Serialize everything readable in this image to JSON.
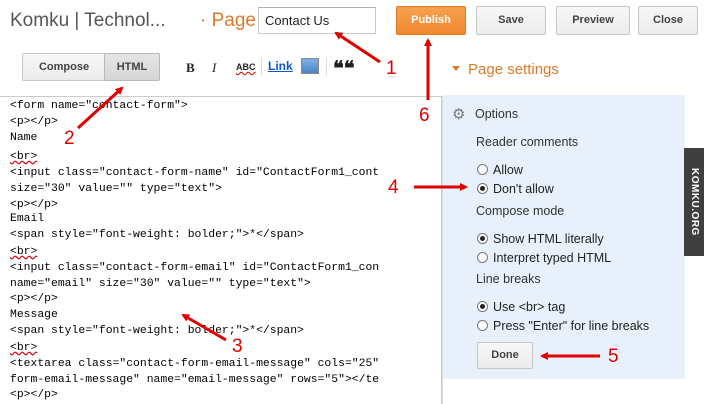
{
  "header": {
    "blog_title": "Komku | Technol...",
    "page_label": "· Page",
    "page_title_value": "Contact Us",
    "publish_label": "Publish",
    "save_label": "Save",
    "preview_label": "Preview",
    "close_label": "Close"
  },
  "editor_modes": {
    "compose_label": "Compose",
    "html_label": "HTML",
    "active": "HTML"
  },
  "toolbar": {
    "bold_label": "B",
    "italic_label": "I",
    "spellcheck_label": "ABC",
    "link_label": "Link",
    "image_icon": "image-icon",
    "quote_label": "❝❝"
  },
  "code_lines": [
    "<form name=\"contact-form\">",
    "<p></p>",
    "Name",
    "<br>",
    "<input class=\"contact-form-name\" id=\"ContactForm1_cont",
    "size=\"30\" value=\"\" type=\"text\">",
    "<p></p>",
    "Email",
    "<span style=\"font-weight: bolder;\">*</span>",
    "<br>",
    "<input class=\"contact-form-email\" id=\"ContactForm1_con",
    "name=\"email\" size=\"30\" value=\"\" type=\"text\">",
    "<p></p>",
    "Message",
    "<span style=\"font-weight: bolder;\">*</span>",
    "<br>",
    "<textarea class=\"contact-form-email-message\" cols=\"25\"",
    "form-email-message\" name=\"email-message\" rows=\"5\"></te",
    "<p></p>"
  ],
  "page_settings": {
    "title": "Page settings",
    "options_title": "Options",
    "reader_comments": {
      "label": "Reader comments",
      "options": [
        "Allow",
        "Don't allow"
      ],
      "selected": "Don't allow"
    },
    "compose_mode": {
      "label": "Compose mode",
      "options": [
        "Show HTML literally",
        "Interpret typed HTML"
      ],
      "selected": "Show HTML literally"
    },
    "line_breaks": {
      "label": "Line breaks",
      "options": [
        "Use <br> tag",
        "Press \"Enter\" for line breaks"
      ],
      "selected": "Use <br> tag"
    },
    "done_label": "Done"
  },
  "watermark": "KOMKU.ORG",
  "annotations": [
    "1",
    "2",
    "3",
    "4",
    "5",
    "6"
  ],
  "colors": {
    "accent_orange": "#f08830",
    "annotation_red": "#e00000",
    "options_bg": "#e8f0fb"
  }
}
